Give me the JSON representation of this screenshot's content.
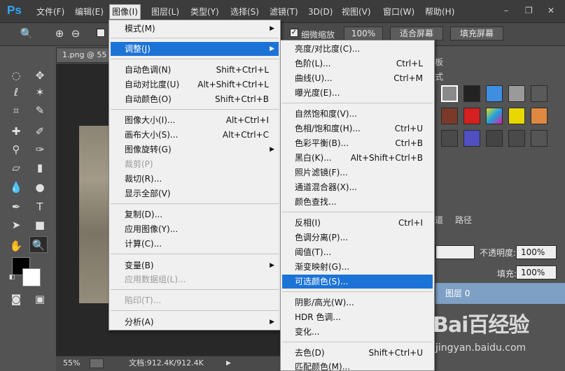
{
  "app": {
    "logo": "Ps"
  },
  "menubar": {
    "items": [
      "文件(F)",
      "编辑(E)",
      "图像(I)",
      "图层(L)",
      "类型(Y)",
      "选择(S)",
      "滤镜(T)",
      "3D(D)",
      "视图(V)",
      "窗口(W)",
      "帮助(H)"
    ],
    "active": "图像(I)",
    "window_controls": [
      "–",
      "❐",
      "✕"
    ]
  },
  "options_bar": {
    "scrubby_zoom_label": "细微缩放",
    "zoom_percent": "100%",
    "fit_screen": "适合屏幕",
    "fill_screen": "填充屏幕"
  },
  "document": {
    "tab_label": "1.png @ 55",
    "zoom_status": "55%",
    "doc_size": "文档:912.4K/912.4K"
  },
  "panels": {
    "style_tab_fragment": "式",
    "board_tab_fragment": "板",
    "layers_tab_fragment": "道",
    "paths_tab": "路径",
    "opacity_label": "不透明度:",
    "opacity_value": "100%",
    "fill_label": "填充:",
    "fill_value": "100%",
    "layer_name": "图层 0"
  },
  "image_menu": {
    "items": [
      {
        "label": "模式(M)",
        "submenu": true
      },
      {
        "label": "调整(J)",
        "submenu": true,
        "highlighted": true
      },
      {
        "label": "自动色调(N)",
        "shortcut": "Shift+Ctrl+L"
      },
      {
        "label": "自动对比度(U)",
        "shortcut": "Alt+Shift+Ctrl+L"
      },
      {
        "label": "自动颜色(O)",
        "shortcut": "Shift+Ctrl+B"
      },
      {
        "label": "图像大小(I)...",
        "shortcut": "Alt+Ctrl+I"
      },
      {
        "label": "画布大小(S)...",
        "shortcut": "Alt+Ctrl+C"
      },
      {
        "label": "图像旋转(G)",
        "submenu": true
      },
      {
        "label": "裁剪(P)",
        "disabled": true
      },
      {
        "label": "裁切(R)..."
      },
      {
        "label": "显示全部(V)"
      },
      {
        "label": "复制(D)..."
      },
      {
        "label": "应用图像(Y)..."
      },
      {
        "label": "计算(C)..."
      },
      {
        "label": "变量(B)",
        "submenu": true
      },
      {
        "label": "应用数据组(L)...",
        "disabled": true
      },
      {
        "label": "陷印(T)...",
        "disabled": true
      },
      {
        "label": "分析(A)",
        "submenu": true
      }
    ]
  },
  "adjust_menu": {
    "items": [
      {
        "label": "亮度/对比度(C)..."
      },
      {
        "label": "色阶(L)...",
        "shortcut": "Ctrl+L"
      },
      {
        "label": "曲线(U)...",
        "shortcut": "Ctrl+M"
      },
      {
        "label": "曝光度(E)..."
      },
      {
        "label": "自然饱和度(V)..."
      },
      {
        "label": "色相/饱和度(H)...",
        "shortcut": "Ctrl+U"
      },
      {
        "label": "色彩平衡(B)...",
        "shortcut": "Ctrl+B"
      },
      {
        "label": "黑白(K)...",
        "shortcut": "Alt+Shift+Ctrl+B"
      },
      {
        "label": "照片滤镜(F)..."
      },
      {
        "label": "通道混合器(X)..."
      },
      {
        "label": "颜色查找..."
      },
      {
        "label": "反相(I)",
        "shortcut": "Ctrl+I"
      },
      {
        "label": "色调分离(P)..."
      },
      {
        "label": "阈值(T)..."
      },
      {
        "label": "渐变映射(G)..."
      },
      {
        "label": "可选颜色(S)...",
        "highlighted": true
      },
      {
        "label": "阴影/高光(W)..."
      },
      {
        "label": "HDR 色调..."
      },
      {
        "label": "变化..."
      },
      {
        "label": "去色(D)",
        "shortcut": "Shift+Ctrl+U"
      },
      {
        "label": "匹配颜色(M)..."
      }
    ]
  },
  "watermark": {
    "logo": "Bai百经验",
    "url": "jingyan.baidu.com"
  },
  "colors": {
    "highlight": "#1c73d6",
    "menu_bg": "#f0f0f0",
    "app_bg": "#535353",
    "menubar_bg": "#3c3c3c",
    "ps_blue": "#31a8ff",
    "layer_selected": "#7ea0c4"
  }
}
